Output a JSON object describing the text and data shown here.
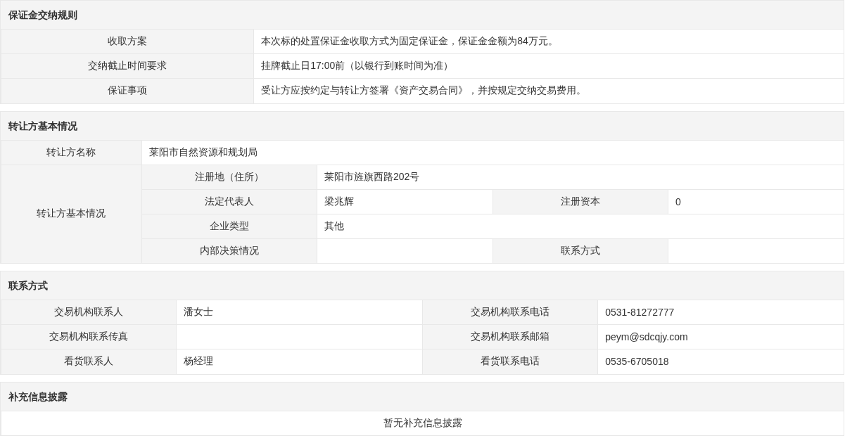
{
  "sections": [
    {
      "kind": "rules",
      "title": "保证金交纳规则",
      "rows": [
        {
          "label": "收取方案",
          "value": "本次标的处置保证金收取方式为固定保证金，保证金金额为84万元。"
        },
        {
          "label": "交纳截止时间要求",
          "value": "挂牌截止日17:00前（以银行到账时间为准）"
        },
        {
          "label": "保证事项",
          "value": "受让方应按约定与转让方签署《资产交易合同》，并按规定交纳交易费用。"
        }
      ]
    },
    {
      "kind": "transferor",
      "title": "转让方基本情况",
      "name": {
        "label": "转让方名称",
        "value": "莱阳市自然资源和规划局"
      },
      "details": {
        "label": "转让方基本情况",
        "rows": [
          {
            "cells": [
              {
                "kind": "label",
                "text": "注册地（住所）"
              },
              {
                "kind": "value",
                "text": "莱阳市旌旗西路202号",
                "colspan": 3
              }
            ]
          },
          {
            "cells": [
              {
                "kind": "label",
                "text": "法定代表人"
              },
              {
                "kind": "value",
                "text": "梁兆辉"
              },
              {
                "kind": "label",
                "text": "注册资本"
              },
              {
                "kind": "value",
                "text": "0"
              }
            ]
          },
          {
            "cells": [
              {
                "kind": "label",
                "text": "企业类型"
              },
              {
                "kind": "value",
                "text": "其他",
                "colspan": 3
              }
            ]
          },
          {
            "cells": [
              {
                "kind": "label",
                "text": "内部决策情况"
              },
              {
                "kind": "value"
              },
              {
                "kind": "label",
                "text": "联系方式"
              },
              {
                "kind": "value"
              }
            ]
          }
        ]
      }
    },
    {
      "kind": "contacts",
      "title": "联系方式",
      "rows": [
        {
          "cells": [
            {
              "kind": "label",
              "text": "交易机构联系人"
            },
            {
              "kind": "value",
              "text": "潘女士"
            },
            {
              "kind": "label",
              "text": "交易机构联系电话"
            },
            {
              "kind": "value",
              "text": "0531-81272777"
            }
          ]
        },
        {
          "cells": [
            {
              "kind": "label",
              "text": "交易机构联系传真"
            },
            {
              "kind": "value"
            },
            {
              "kind": "label",
              "text": "交易机构联系邮箱"
            },
            {
              "kind": "value",
              "text": "peym@sdcqjy.com"
            }
          ]
        },
        {
          "cells": [
            {
              "kind": "label",
              "text": "看货联系人"
            },
            {
              "kind": "value",
              "text": "杨经理"
            },
            {
              "kind": "label",
              "text": "看货联系电话"
            },
            {
              "kind": "value",
              "text": "0535-6705018"
            }
          ]
        }
      ]
    },
    {
      "kind": "note",
      "title": "补充信息披露",
      "text": "暂无补充信息披露"
    }
  ]
}
